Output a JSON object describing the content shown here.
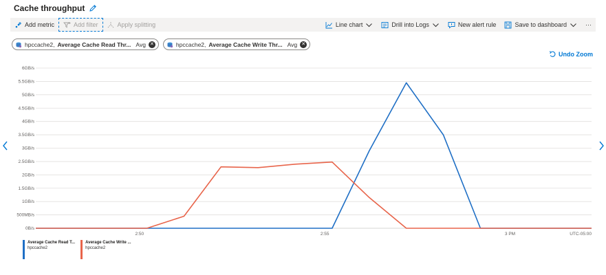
{
  "header": {
    "title": "Cache throughput",
    "edit_icon": "pencil-icon"
  },
  "toolbar": {
    "add_metric": "Add metric",
    "add_filter": "Add filter",
    "apply_splitting": "Apply splitting",
    "line_chart": "Line chart",
    "drill_into_logs": "Drill into Logs",
    "new_alert_rule": "New alert rule",
    "save_to_dashboard": "Save to dashboard",
    "more": "···"
  },
  "metrics": [
    {
      "resource": "hpccache2, ",
      "metric": "Average Cache Read Thr...",
      "aggregation": "Avg",
      "color": "#1f6fc5"
    },
    {
      "resource": "hpccache2, ",
      "metric": "Average Cache Write Thr...",
      "aggregation": "Avg",
      "color": "#e8644a"
    }
  ],
  "undo_zoom": "Undo Zoom",
  "timezone": "UTC-05:00",
  "legend": [
    {
      "name": "Average Cache Read T...",
      "resource": "hpccache2",
      "color": "#1f6fc5"
    },
    {
      "name": "Average Cache Write ...",
      "resource": "hpccache2",
      "color": "#e8644a"
    }
  ],
  "chart_data": {
    "type": "line",
    "y_ticks": [
      "0B/s",
      "500MB/s",
      "1GB/s",
      "1.5GB/s",
      "2GB/s",
      "2.5GB/s",
      "3GB/s",
      "3.5GB/s",
      "4GB/s",
      "4.5GB/s",
      "5GB/s",
      "5.5GB/s",
      "6GB/s"
    ],
    "ylim": [
      0,
      6
    ],
    "y_unit": "GB/s",
    "x_ticks": [
      {
        "label": "2:50",
        "value": 2.8
      },
      {
        "label": "2:55",
        "value": 7.8
      },
      {
        "label": "3 PM",
        "value": 12.8
      }
    ],
    "xlim": [
      0,
      15
    ],
    "series": [
      {
        "name": "Average Cache Read Throughput",
        "color": "#1f6fc5",
        "x": [
          0,
          1,
          2,
          3,
          4,
          5,
          6,
          7,
          8,
          9,
          10,
          11,
          12,
          13,
          14,
          15
        ],
        "values": [
          0,
          0,
          0,
          0,
          0,
          0,
          0,
          0,
          0,
          2.9,
          5.45,
          3.5,
          0,
          0,
          0,
          0
        ]
      },
      {
        "name": "Average Cache Write Throughput",
        "color": "#e8644a",
        "x": [
          0,
          1,
          2,
          3,
          4,
          5,
          6,
          7,
          8,
          9,
          10,
          11,
          12,
          13,
          14,
          15
        ],
        "values": [
          0,
          0,
          0,
          0,
          0.45,
          2.3,
          2.27,
          2.4,
          2.48,
          1.15,
          0,
          0,
          0,
          0,
          0,
          0
        ]
      }
    ],
    "grid": true,
    "legend": "bottom-left"
  }
}
